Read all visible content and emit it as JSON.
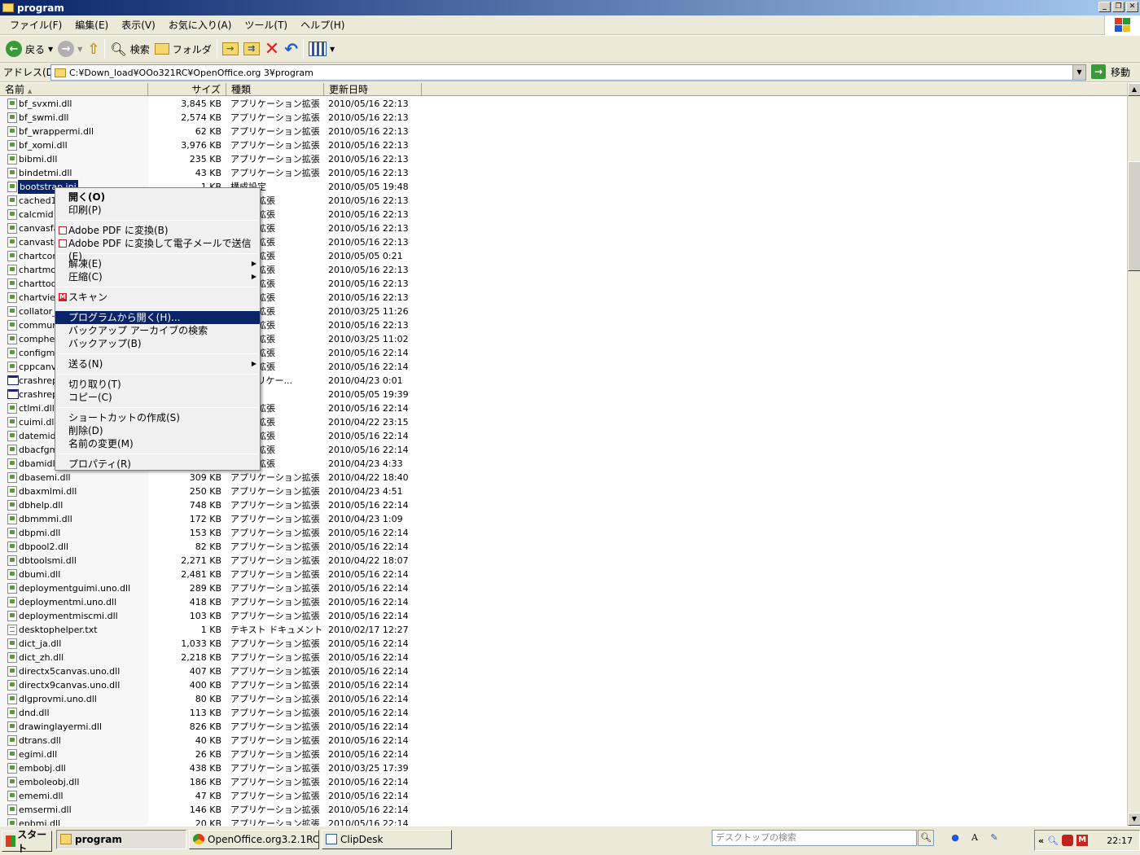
{
  "window": {
    "title": "program"
  },
  "menu": [
    "ファイル(F)",
    "編集(E)",
    "表示(V)",
    "お気に入り(A)",
    "ツール(T)",
    "ヘルプ(H)"
  ],
  "toolbar": {
    "back": "戻る",
    "search": "検索",
    "folder": "フォルダ"
  },
  "address": {
    "label": "アドレス(D)",
    "path": "C:¥Down_load¥OOo321RC¥OpenOffice.org 3¥program",
    "go": "移動"
  },
  "columns": {
    "name": "名前",
    "size": "サイズ",
    "type": "種類",
    "date": "更新日時"
  },
  "files": [
    {
      "name": "bf_svxmi.dll",
      "size": "3,845 KB",
      "type": "アプリケーション拡張",
      "date": "2010/05/16 22:13"
    },
    {
      "name": "bf_swmi.dll",
      "size": "2,574 KB",
      "type": "アプリケーション拡張",
      "date": "2010/05/16 22:13"
    },
    {
      "name": "bf_wrappermi.dll",
      "size": "62 KB",
      "type": "アプリケーション拡張",
      "date": "2010/05/16 22:13"
    },
    {
      "name": "bf_xomi.dll",
      "size": "3,976 KB",
      "type": "アプリケーション拡張",
      "date": "2010/05/16 22:13"
    },
    {
      "name": "bibmi.dll",
      "size": "235 KB",
      "type": "アプリケーション拡張",
      "date": "2010/05/16 22:13"
    },
    {
      "name": "bindetmi.dll",
      "size": "43 KB",
      "type": "アプリケーション拡張",
      "date": "2010/05/16 22:13"
    },
    {
      "name": "bootstrap.ini",
      "size": "1 KB",
      "type": "構成設定",
      "date": "2010/05/05 19:48"
    },
    {
      "name": "cached1",
      "size": "",
      "type": "ション拡張",
      "date": "2010/05/16 22:13"
    },
    {
      "name": "calcmid",
      "size": "",
      "type": "ション拡張",
      "date": "2010/05/16 22:13"
    },
    {
      "name": "canvasfa",
      "size": "",
      "type": "ション拡張",
      "date": "2010/05/16 22:13"
    },
    {
      "name": "canvasto",
      "size": "",
      "type": "ション拡張",
      "date": "2010/05/16 22:13"
    },
    {
      "name": "chartcon",
      "size": "",
      "type": "ション拡張",
      "date": "2010/05/05 0:21"
    },
    {
      "name": "chartmod",
      "size": "",
      "type": "ション拡張",
      "date": "2010/05/16 22:13"
    },
    {
      "name": "charttoo",
      "size": "",
      "type": "ション拡張",
      "date": "2010/05/16 22:13"
    },
    {
      "name": "chartvie",
      "size": "",
      "type": "ション拡張",
      "date": "2010/05/16 22:13"
    },
    {
      "name": "collator_",
      "size": "",
      "type": "ション拡張",
      "date": "2010/03/25 11:26"
    },
    {
      "name": "commun",
      "size": "",
      "type": "ション拡張",
      "date": "2010/05/16 22:13"
    },
    {
      "name": "comphel",
      "size": "",
      "type": "ション拡張",
      "date": "2010/03/25 11:02"
    },
    {
      "name": "configme",
      "size": "",
      "type": "ション拡張",
      "date": "2010/05/16 22:14"
    },
    {
      "name": "cppcanv",
      "size": "",
      "type": "ション拡張",
      "date": "2010/05/16 22:14"
    },
    {
      "name": "crashrep",
      "size": "",
      "type": "S アプリケー...",
      "date": "2010/04/23 0:01"
    },
    {
      "name": "crashrep",
      "size": "",
      "type": "ション",
      "date": "2010/05/05 19:39"
    },
    {
      "name": "ctlmi.dll",
      "size": "",
      "type": "ション拡張",
      "date": "2010/05/16 22:14"
    },
    {
      "name": "cuimi.dll",
      "size": "",
      "type": "ション拡張",
      "date": "2010/04/22 23:15"
    },
    {
      "name": "datemid",
      "size": "",
      "type": "ション拡張",
      "date": "2010/05/16 22:14"
    },
    {
      "name": "dbacfgm",
      "size": "",
      "type": "ション拡張",
      "date": "2010/05/16 22:14"
    },
    {
      "name": "dbamidl",
      "size": "",
      "type": "ション拡張",
      "date": "2010/04/23 4:33"
    },
    {
      "name": "dbasemi.dll",
      "size": "309 KB",
      "type": "アプリケーション拡張",
      "date": "2010/04/22 18:40"
    },
    {
      "name": "dbaxmlmi.dll",
      "size": "250 KB",
      "type": "アプリケーション拡張",
      "date": "2010/04/23 4:51"
    },
    {
      "name": "dbhelp.dll",
      "size": "748 KB",
      "type": "アプリケーション拡張",
      "date": "2010/05/16 22:14"
    },
    {
      "name": "dbmmmi.dll",
      "size": "172 KB",
      "type": "アプリケーション拡張",
      "date": "2010/04/23 1:09"
    },
    {
      "name": "dbpmi.dll",
      "size": "153 KB",
      "type": "アプリケーション拡張",
      "date": "2010/05/16 22:14"
    },
    {
      "name": "dbpool2.dll",
      "size": "82 KB",
      "type": "アプリケーション拡張",
      "date": "2010/05/16 22:14"
    },
    {
      "name": "dbtoolsmi.dll",
      "size": "2,271 KB",
      "type": "アプリケーション拡張",
      "date": "2010/04/22 18:07"
    },
    {
      "name": "dbumi.dll",
      "size": "2,481 KB",
      "type": "アプリケーション拡張",
      "date": "2010/05/16 22:14"
    },
    {
      "name": "deploymentguimi.uno.dll",
      "size": "289 KB",
      "type": "アプリケーション拡張",
      "date": "2010/05/16 22:14"
    },
    {
      "name": "deploymentmi.uno.dll",
      "size": "418 KB",
      "type": "アプリケーション拡張",
      "date": "2010/05/16 22:14"
    },
    {
      "name": "deploymentmiscmi.dll",
      "size": "103 KB",
      "type": "アプリケーション拡張",
      "date": "2010/05/16 22:14"
    },
    {
      "name": "desktophelper.txt",
      "size": "1 KB",
      "type": "テキスト ドキュメント",
      "date": "2010/02/17 12:27"
    },
    {
      "name": "dict_ja.dll",
      "size": "1,033 KB",
      "type": "アプリケーション拡張",
      "date": "2010/05/16 22:14"
    },
    {
      "name": "dict_zh.dll",
      "size": "2,218 KB",
      "type": "アプリケーション拡張",
      "date": "2010/05/16 22:14"
    },
    {
      "name": "directx5canvas.uno.dll",
      "size": "407 KB",
      "type": "アプリケーション拡張",
      "date": "2010/05/16 22:14"
    },
    {
      "name": "directx9canvas.uno.dll",
      "size": "400 KB",
      "type": "アプリケーション拡張",
      "date": "2010/05/16 22:14"
    },
    {
      "name": "dlgprovmi.uno.dll",
      "size": "80 KB",
      "type": "アプリケーション拡張",
      "date": "2010/05/16 22:14"
    },
    {
      "name": "dnd.dll",
      "size": "113 KB",
      "type": "アプリケーション拡張",
      "date": "2010/05/16 22:14"
    },
    {
      "name": "drawinglayermi.dll",
      "size": "826 KB",
      "type": "アプリケーション拡張",
      "date": "2010/05/16 22:14"
    },
    {
      "name": "dtrans.dll",
      "size": "40 KB",
      "type": "アプリケーション拡張",
      "date": "2010/05/16 22:14"
    },
    {
      "name": "egimi.dll",
      "size": "26 KB",
      "type": "アプリケーション拡張",
      "date": "2010/05/16 22:14"
    },
    {
      "name": "embobj.dll",
      "size": "438 KB",
      "type": "アプリケーション拡張",
      "date": "2010/03/25 17:39"
    },
    {
      "name": "emboleobj.dll",
      "size": "186 KB",
      "type": "アプリケーション拡張",
      "date": "2010/05/16 22:14"
    },
    {
      "name": "ememi.dll",
      "size": "47 KB",
      "type": "アプリケーション拡張",
      "date": "2010/05/16 22:14"
    },
    {
      "name": "emsermi.dll",
      "size": "146 KB",
      "type": "アプリケーション拡張",
      "date": "2010/05/16 22:14"
    },
    {
      "name": "epbmi.dll",
      "size": "20 KB",
      "type": "アプリケーション拡張",
      "date": "2010/05/16 22:14"
    }
  ],
  "context_menu": {
    "open": "開く(O)",
    "print": "印刷(P)",
    "pdf": "Adobe PDF に変換(B)",
    "pdf_mail": "Adobe PDF に変換して電子メールで送信(E)",
    "extract": "解凍(E)",
    "compress": "圧縮(C)",
    "scan": "スキャン",
    "open_with": "プログラムから開く(H)...",
    "backup_search": "バックアップ アーカイブの検索",
    "backup": "バックアップ(B)",
    "send_to": "送る(N)",
    "cut": "切り取り(T)",
    "copy": "コピー(C)",
    "shortcut": "ショートカットの作成(S)",
    "delete": "削除(D)",
    "rename": "名前の変更(M)",
    "properties": "プロパティ(R)"
  },
  "taskbar": {
    "start": "スタート",
    "tasks": [
      "program",
      "OpenOffice.org3.2.1RC版...",
      "ClipDesk"
    ],
    "search_placeholder": "デスクトップの検索",
    "clock": "22:17"
  }
}
